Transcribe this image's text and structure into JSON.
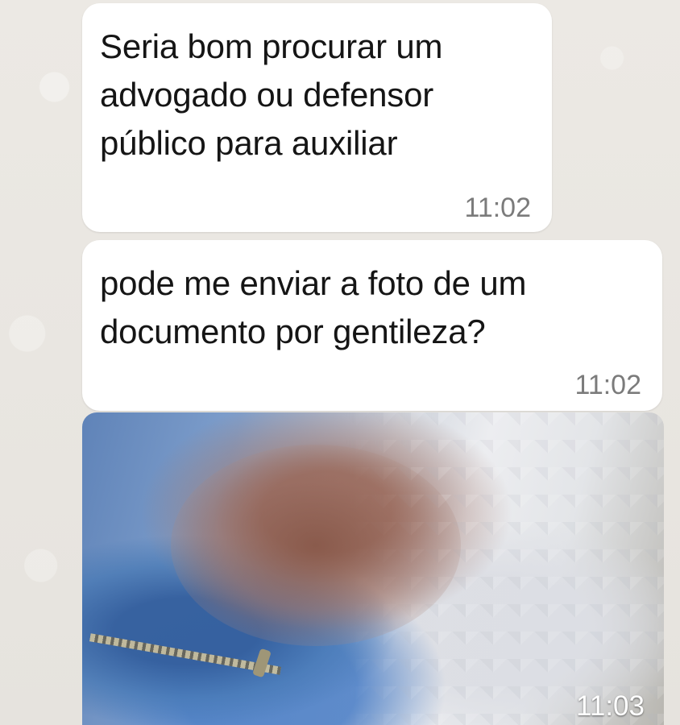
{
  "messages": [
    {
      "text": "Seria bom procurar um\nadvogado ou defensor\npúblico para auxiliar",
      "time": "11:02"
    },
    {
      "text": "pode me enviar a foto de um\ndocumento por gentileza?",
      "time": "11:02"
    },
    {
      "type": "image",
      "time": "11:03"
    }
  ],
  "colors": {
    "background": "#e9e6e1",
    "bubble": "#ffffff",
    "text": "#151515",
    "timestamp": "#7b7b7b"
  }
}
